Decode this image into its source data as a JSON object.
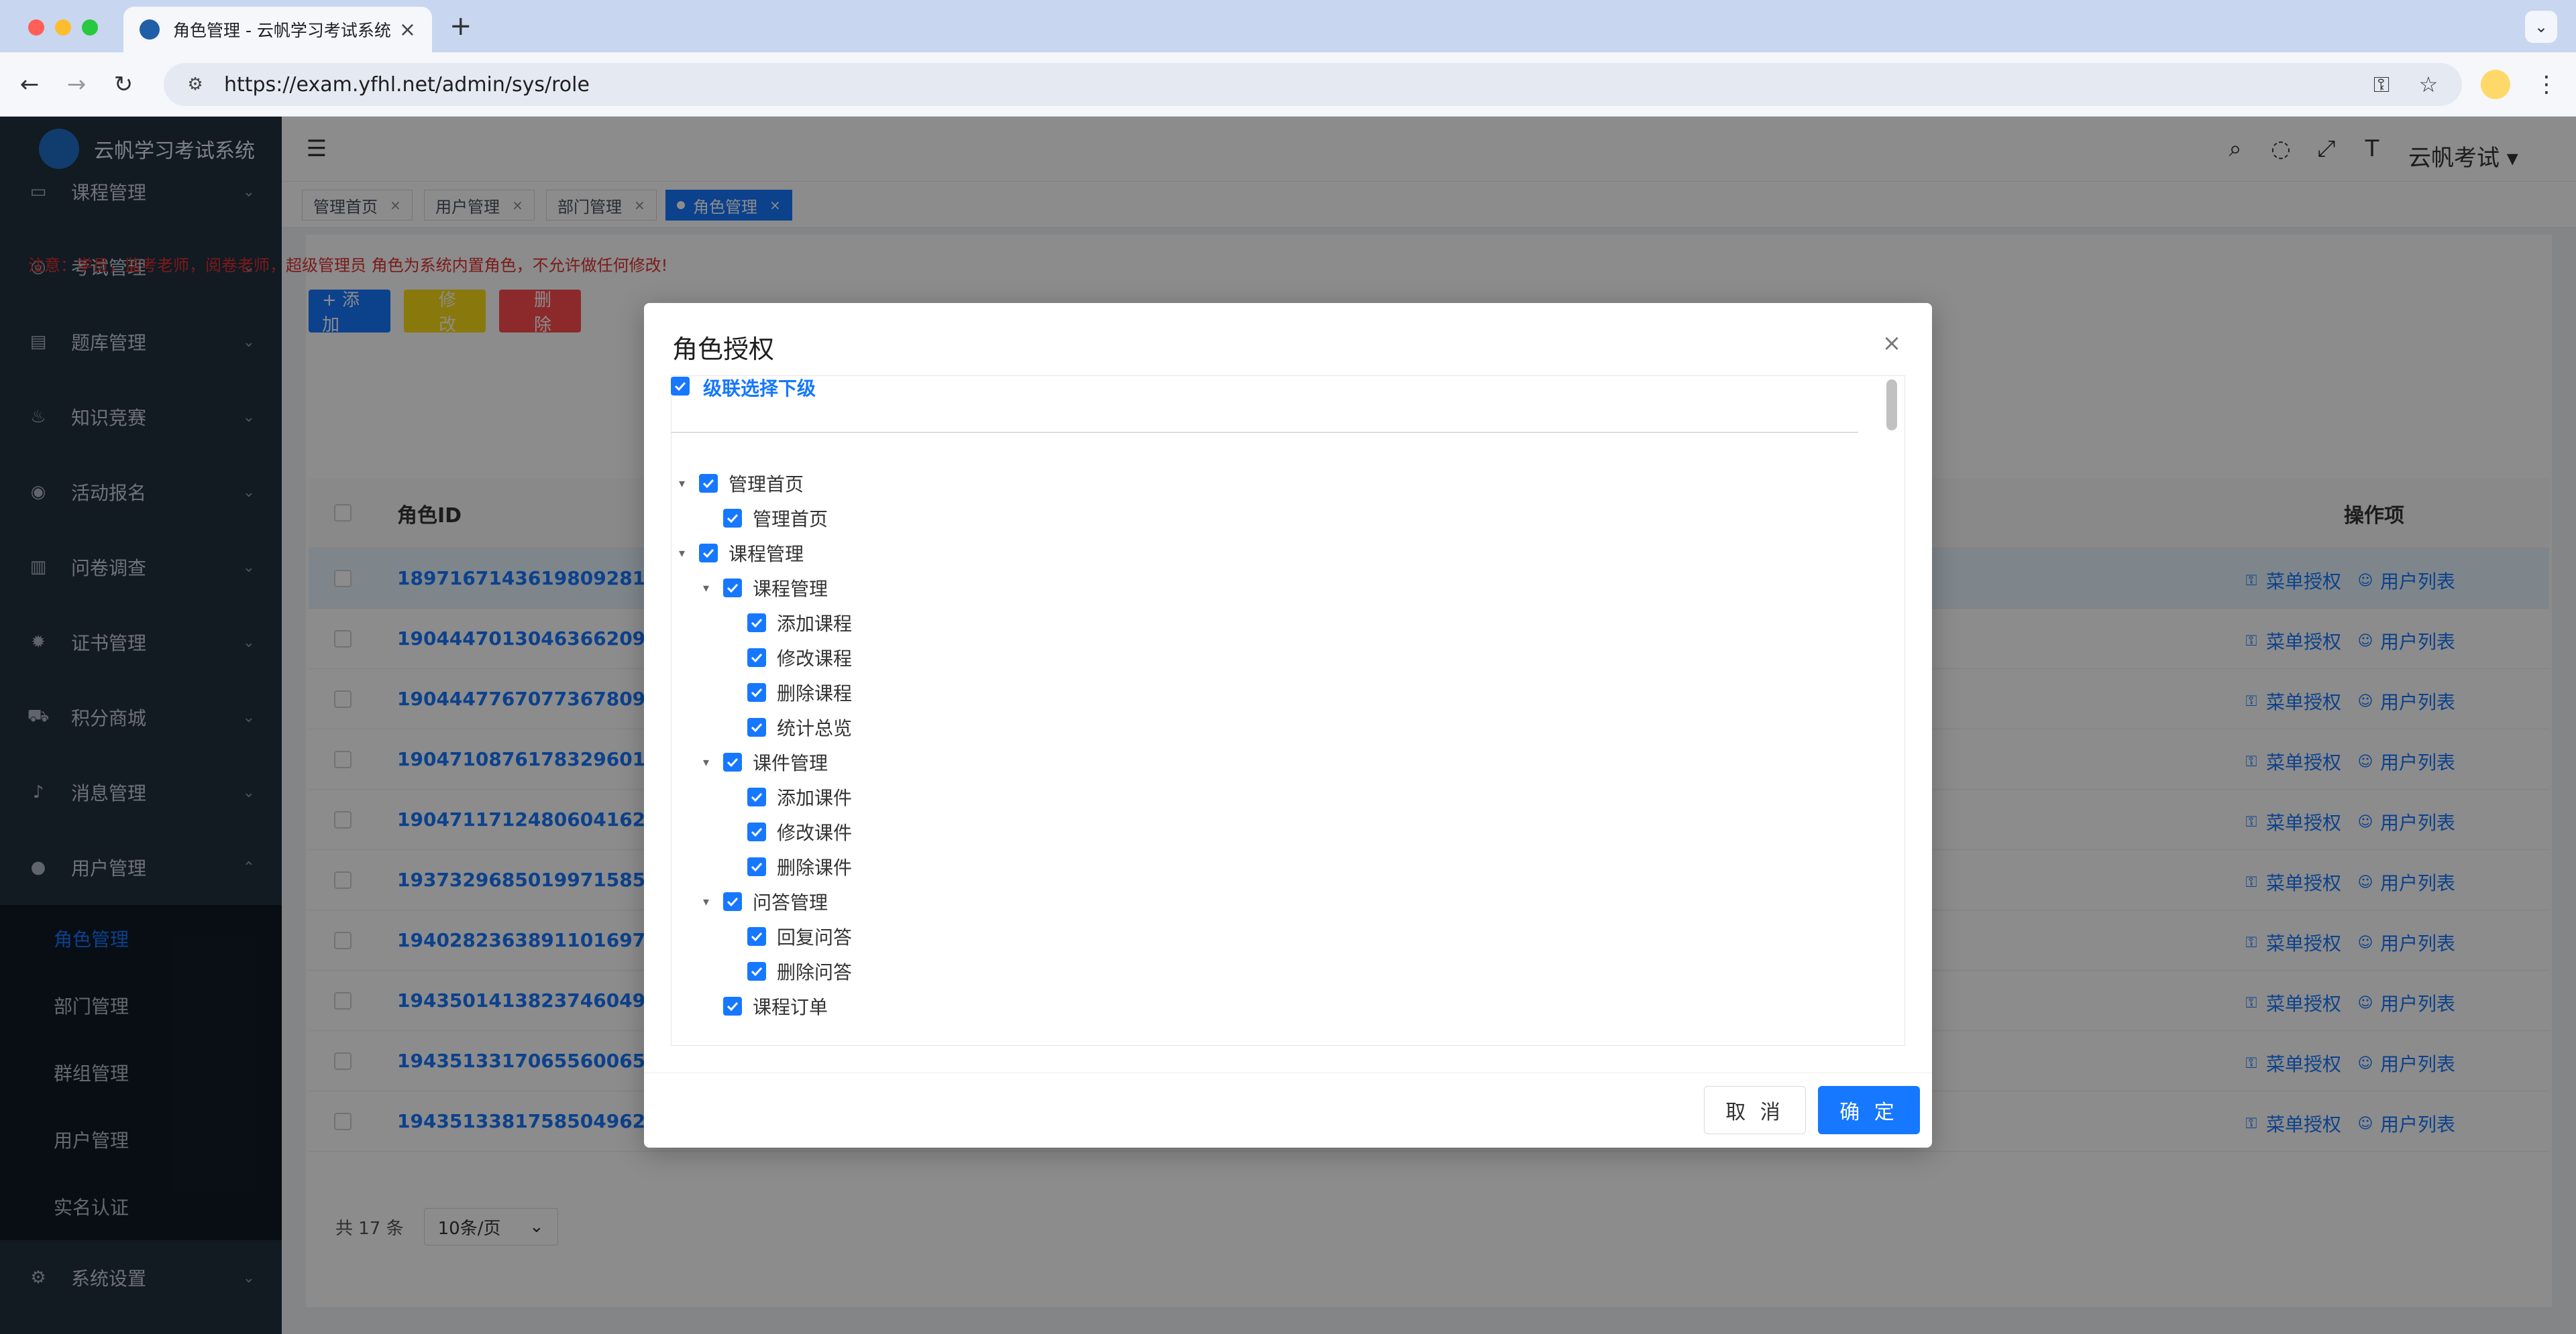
{
  "browser": {
    "tab_title": "角色管理 - 云帆学习考试系统",
    "url": "https://exam.yfhl.net/admin/sys/role",
    "new_tab_symbol": "+",
    "traffic_colors": [
      "#ff5f57",
      "#febc2e",
      "#28c840"
    ]
  },
  "sidebar": {
    "brand": "云帆学习考试系统",
    "items": [
      {
        "label": "课程管理",
        "icon": "monitor-icon"
      },
      {
        "label": "考试管理",
        "icon": "target-icon"
      },
      {
        "label": "题库管理",
        "icon": "document-icon"
      },
      {
        "label": "知识竞赛",
        "icon": "fire-icon"
      },
      {
        "label": "活动报名",
        "icon": "badge-icon"
      },
      {
        "label": "问卷调查",
        "icon": "book-icon"
      },
      {
        "label": "证书管理",
        "icon": "certificate-icon"
      },
      {
        "label": "积分商城",
        "icon": "cart-icon"
      },
      {
        "label": "消息管理",
        "icon": "bell-icon"
      },
      {
        "label": "用户管理",
        "icon": "user-icon"
      }
    ],
    "user_submenu": [
      "角色管理",
      "部门管理",
      "群组管理",
      "用户管理",
      "实名认证"
    ],
    "system_settings": "系统设置"
  },
  "header": {
    "user_name": "云帆考试"
  },
  "tags": [
    "管理首页",
    "用户管理",
    "部门管理",
    "角色管理"
  ],
  "notice": "注意：学员，监考老师，阅卷老师，超级管理员 角色为系统内置角色，不允许做任何修改!",
  "actions": {
    "add": "+ 添加",
    "edit": "修改",
    "delete": "删除"
  },
  "table": {
    "col_role_id": "角色ID",
    "col_ops": "操作项",
    "rows": [
      "1897167143619809281",
      "1904447013046366209",
      "1904447767077367809",
      "1904710876178329601",
      "1904711712480604162",
      "1937329685019971585",
      "1940282363891101697",
      "1943501413823746049",
      "1943513317065560065",
      "1943513381758504962"
    ],
    "op_menu_auth": "菜单授权",
    "op_user_list": "用户列表"
  },
  "pager": {
    "total": "共 17 条",
    "page_size": "10条/页"
  },
  "modal": {
    "title": "角色授权",
    "cascade_label": "级联选择下级",
    "tree": [
      {
        "label": "管理首页",
        "level": 0,
        "expanded": true
      },
      {
        "label": "管理首页",
        "level": 1
      },
      {
        "label": "课程管理",
        "level": 0,
        "expanded": true
      },
      {
        "label": "课程管理",
        "level": 1,
        "expanded": true
      },
      {
        "label": "添加课程",
        "level": 2
      },
      {
        "label": "修改课程",
        "level": 2
      },
      {
        "label": "删除课程",
        "level": 2
      },
      {
        "label": "统计总览",
        "level": 2
      },
      {
        "label": "课件管理",
        "level": 1,
        "expanded": true
      },
      {
        "label": "添加课件",
        "level": 2
      },
      {
        "label": "修改课件",
        "level": 2
      },
      {
        "label": "删除课件",
        "level": 2
      },
      {
        "label": "问答管理",
        "level": 1,
        "expanded": true
      },
      {
        "label": "回复问答",
        "level": 2
      },
      {
        "label": "删除问答",
        "level": 2
      },
      {
        "label": "课程订单",
        "level": 1
      }
    ],
    "cancel": "取 消",
    "ok": "确 定"
  },
  "colors": {
    "accent": "#1677ff",
    "sidebar_bg": "#22303f",
    "danger": "#e03131"
  }
}
